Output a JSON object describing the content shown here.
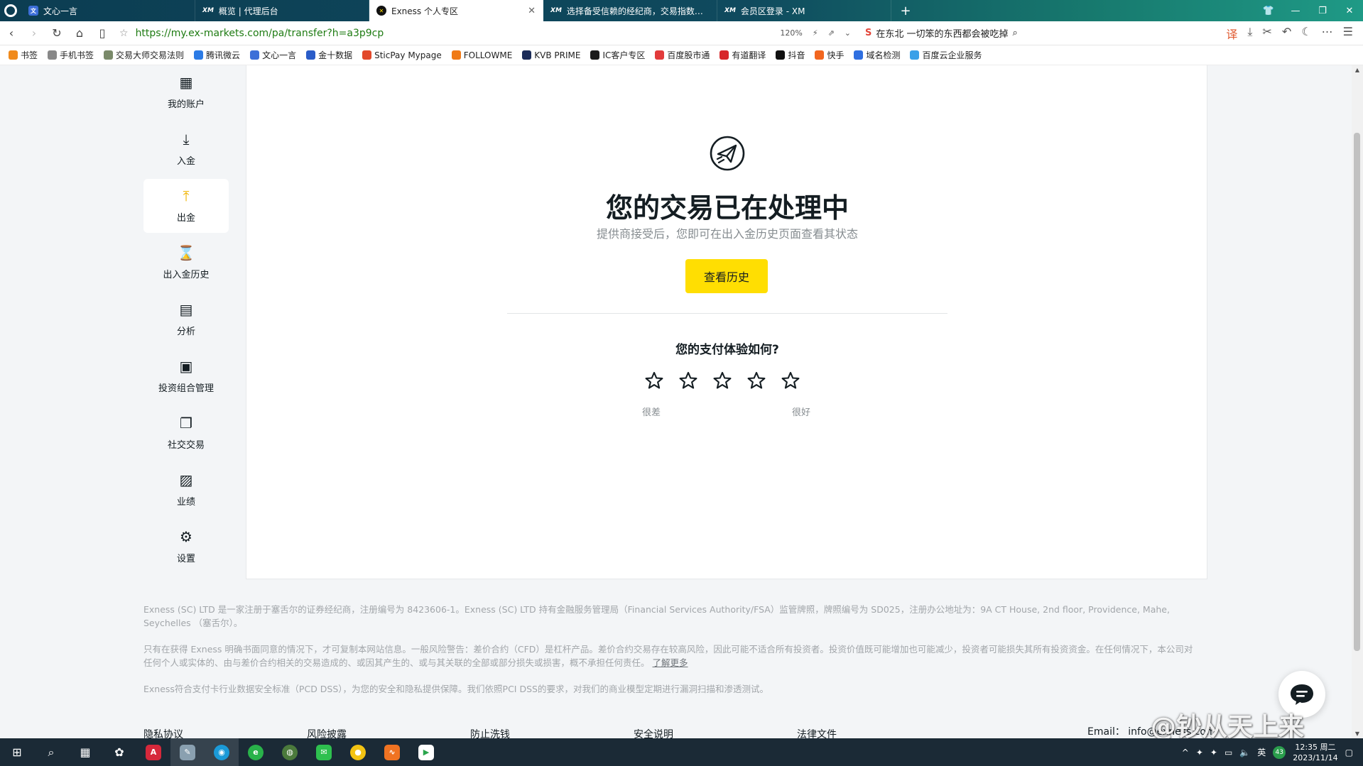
{
  "browser": {
    "tabs": [
      {
        "title": "文心一言",
        "icon": "wenxin-icon",
        "active": false
      },
      {
        "title": "概览 | 代理后台",
        "icon": "xm-logo-icon",
        "active": false
      },
      {
        "title": "Exness 个人专区",
        "icon": "exness-logo-icon",
        "active": true
      },
      {
        "title": "选择备受信赖的经纪商，交易指数、...",
        "icon": "xm-logo-icon",
        "active": false
      },
      {
        "title": "会员区登录 - XM",
        "icon": "xm-logo-icon",
        "active": false
      }
    ],
    "xm_label": "XM",
    "new_tab": "+",
    "url": "https://my.ex-markets.com/pa/transfer?h=a3p9cp",
    "zoom": "120%",
    "search_text": "在东北 一切笨的东西都会被吃掉",
    "bookmarks": [
      {
        "label": "书签",
        "color": "#f08a1c"
      },
      {
        "label": "手机书签",
        "color": "#888888"
      },
      {
        "label": "交易大师交易法则",
        "color": "#7a8a6a"
      },
      {
        "label": "腾讯微云",
        "color": "#2c7be5"
      },
      {
        "label": "文心一言",
        "color": "#3d6fd8"
      },
      {
        "label": "金十数据",
        "color": "#2a5cc8"
      },
      {
        "label": "SticPay Mypage",
        "color": "#e2492b"
      },
      {
        "label": "FOLLOWME",
        "color": "#f07a16"
      },
      {
        "label": "KVB PRIME",
        "color": "#1b2c58"
      },
      {
        "label": "IC客户专区",
        "color": "#1b1b1b"
      },
      {
        "label": "百度股市通",
        "color": "#e23b3b"
      },
      {
        "label": "有道翻译",
        "color": "#d7262a"
      },
      {
        "label": "抖音",
        "color": "#111111"
      },
      {
        "label": "快手",
        "color": "#f2661f"
      },
      {
        "label": "域名检测",
        "color": "#2f6fe0"
      },
      {
        "label": "百度云企业服务",
        "color": "#3aa0e8"
      }
    ]
  },
  "sidebar": {
    "items": [
      {
        "label": "我的账户",
        "icon": "dashboard-grid-icon",
        "active": false
      },
      {
        "label": "入金",
        "icon": "deposit-download-icon",
        "active": false
      },
      {
        "label": "出金",
        "icon": "withdraw-upload-icon",
        "active": true
      },
      {
        "label": "出入金历史",
        "icon": "hourglass-icon",
        "active": false
      },
      {
        "label": "分析",
        "icon": "presentation-chart-icon",
        "active": false
      },
      {
        "label": "投资组合管理",
        "icon": "briefcase-icon",
        "active": false
      },
      {
        "label": "社交交易",
        "icon": "copy-stack-icon",
        "active": false
      },
      {
        "label": "业绩",
        "icon": "performance-chart-icon",
        "active": false
      },
      {
        "label": "设置",
        "icon": "gear-icon",
        "active": false
      }
    ]
  },
  "main": {
    "title": "您的交易已在处理中",
    "subtitle": "提供商接受后，您即可在出入金历史页面查看其状态",
    "history_button": "查看历史",
    "rating_title": "您的支付体验如何?",
    "rating_low": "很差",
    "rating_high": "很好",
    "stars": 5
  },
  "footer": {
    "para1": "Exness (SC) LTD 是一家注册于塞舌尔的证券经纪商，注册编号为 8423606-1。Exness (SC) LTD 持有金融服务管理局（Financial Services Authority/FSA）监管牌照，牌照编号为 SD025，注册办公地址为：9A CT House, 2nd floor, Providence, Mahe, Seychelles （塞舌尔）。",
    "para2": "只有在获得 Exness 明确书面同意的情况下，才可复制本网站信息。一般风险警告：差价合约（CFD）是杠杆产品。差价合约交易存在较高风险，因此可能不适合所有投资者。投资价值既可能增加也可能减少，投资者可能损失其所有投资资金。在任何情况下，本公司对任何个人或实体的、由与差价合约相关的交易造成的、或因其产生的、或与其关联的全部或部分损失或损害，概不承担任何责任。",
    "learn_more": "了解更多",
    "para3": "Exness符合支付卡行业数据安全标准（PCD DSS），为您的安全和隐私提供保障。我们依照PCI DSS的要求，对我们的商业模型定期进行漏洞扫描和渗透测试。",
    "links": [
      "隐私协议",
      "风险披露",
      "防止洗钱",
      "安全说明",
      "法律文件"
    ],
    "email": "Email： info@exness.com"
  },
  "watermark": "@钞从天上来",
  "taskbar": {
    "ime": "英",
    "badge": "43",
    "time": "12:35 周二",
    "date": "2023/11/14"
  },
  "colors": {
    "accent": "#ffde02",
    "active_icon": "#f0b400",
    "text": "#141d22",
    "muted": "#868c90"
  }
}
